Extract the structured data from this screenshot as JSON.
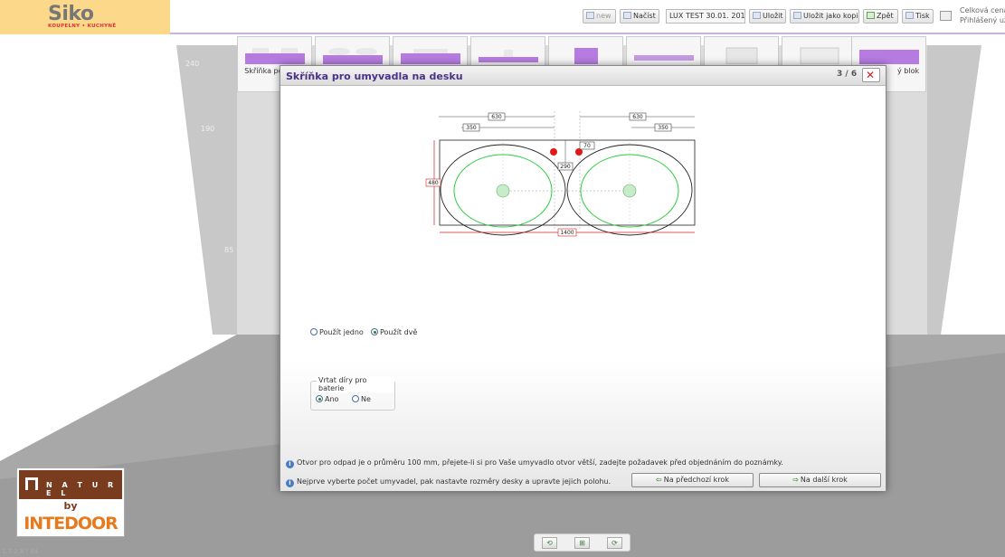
{
  "header": {
    "logo": "Siko",
    "logo_sub": "KOUPELNY • KUCHYNĚ",
    "buttons": {
      "new": "new",
      "load": "Načíst",
      "save": "Uložit",
      "save_copy": "Uložit jako kopii",
      "back": "Zpět",
      "print": "Tisk"
    },
    "project_name": "LUX TEST 30.01. 201",
    "price_label": "Celková cena",
    "user_label": "Přihlášený uživ"
  },
  "room": {
    "levels": [
      "240",
      "190",
      "85"
    ]
  },
  "product_strip": {
    "items": [
      {
        "label": "Skříňka pod umy"
      },
      {
        "label": ""
      },
      {
        "label": ""
      },
      {
        "label": ""
      },
      {
        "label": ""
      },
      {
        "label": ""
      },
      {
        "label": ""
      },
      {
        "label": ""
      },
      {
        "label": "ý blok"
      }
    ]
  },
  "modal": {
    "title": "Skříňka pro umyvadla na desku",
    "step": "3 / 6",
    "options": {
      "use_one": "Použít jedno",
      "use_two": "Použít dvě"
    },
    "faucet": {
      "legend": "Vrtat díry pro baterie",
      "yes": "Ano",
      "no": "Ne"
    },
    "info1": "Otvor pro odpad je o průměru 100 mm, přejete-li si pro Vaše umyvadlo otvor větší, zadejte požadavek před objednáním do poznámky.",
    "info2": "Nejprve vyberte počet umyvadel, pak nastavte rozměry desky a upravte jejich polohu.",
    "prev_button": "Na předchozí krok",
    "next_button": "Na další krok"
  },
  "drawing": {
    "dim_630_left": "630",
    "dim_350_left": "350",
    "dim_630_right": "630",
    "dim_350_right": "350",
    "dim_70": "70",
    "dim_290": "290",
    "dim_480": "480",
    "dim_1400": "1400"
  },
  "naturel_logo": {
    "word": "N A T U R E L",
    "by": "by",
    "brand": "INTEDOOR"
  },
  "version": "1.7.2.8 | 84",
  "colors": {
    "accent": "#4a3286",
    "logo_bg": "#fcd98a",
    "basin_inner": "#2ecc40",
    "dimension_red": "#d42020",
    "close_red": "#d41e1e"
  }
}
